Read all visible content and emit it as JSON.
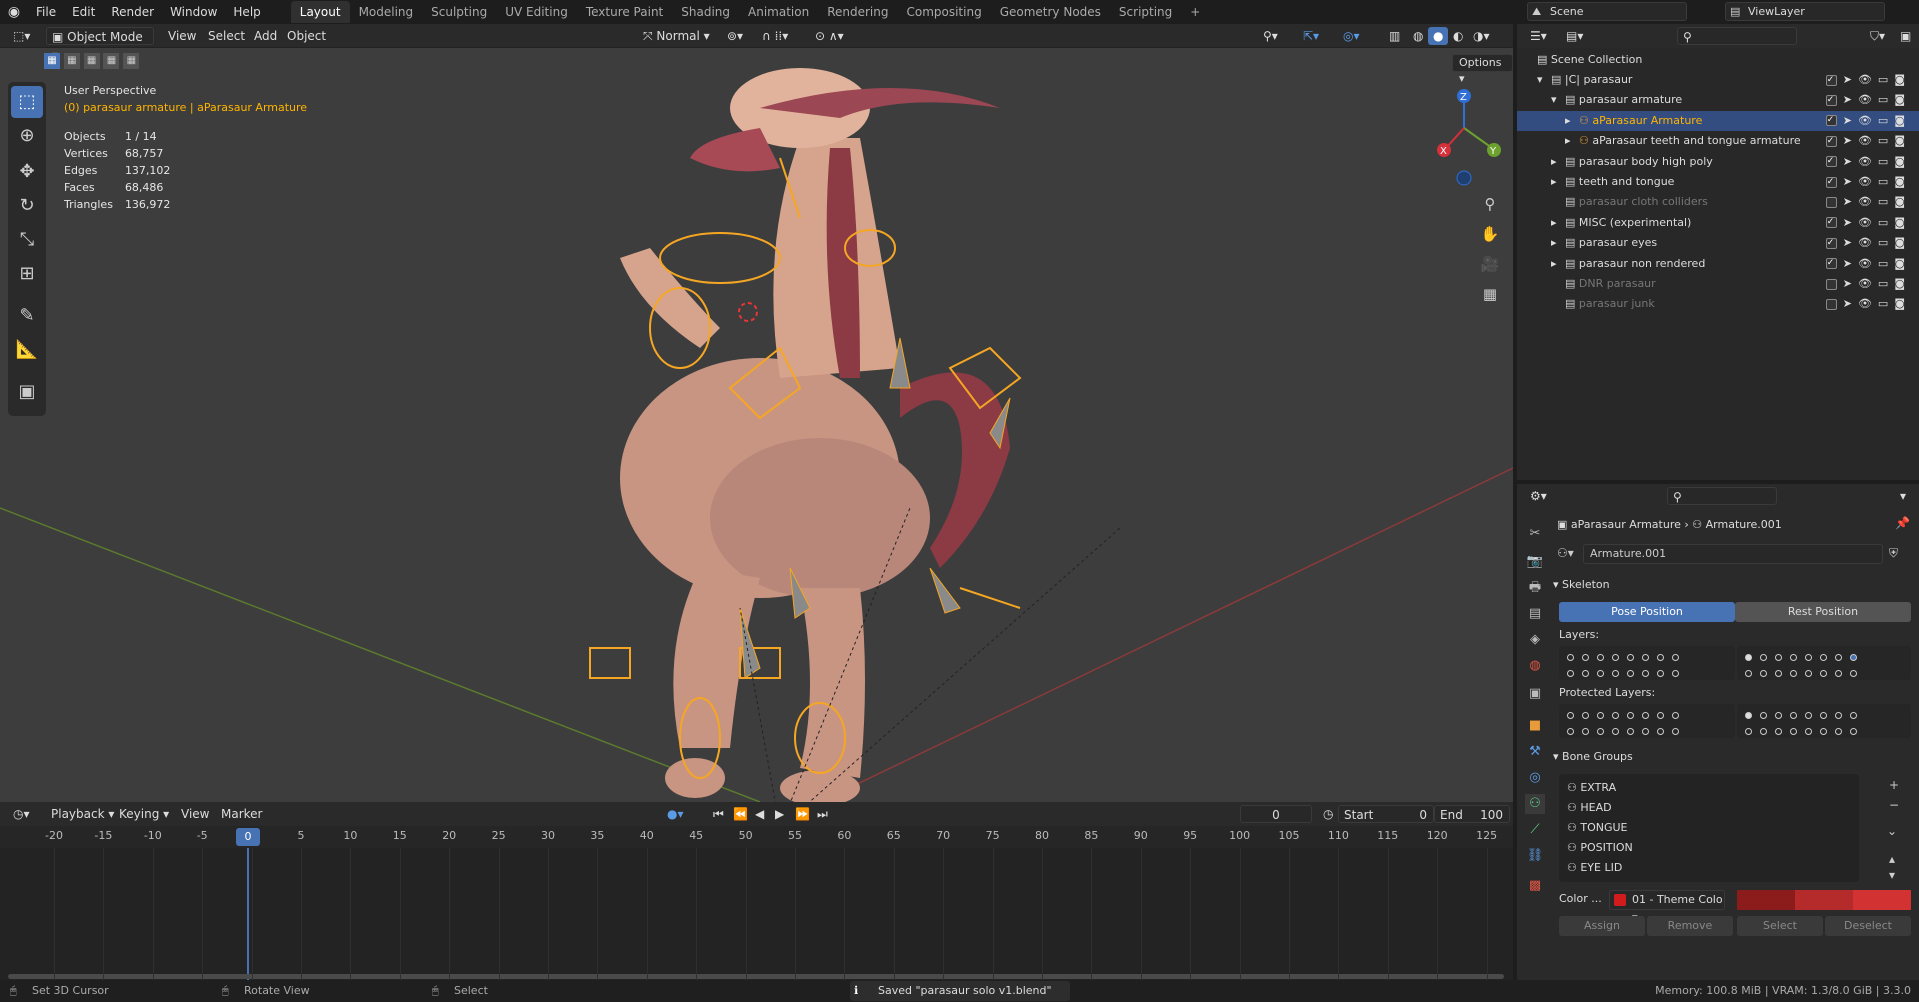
{
  "topbar": {
    "menus": [
      "File",
      "Edit",
      "Render",
      "Window",
      "Help"
    ],
    "workspaces": [
      "Layout",
      "Modeling",
      "Sculpting",
      "UV Editing",
      "Texture Paint",
      "Shading",
      "Animation",
      "Rendering",
      "Compositing",
      "Geometry Nodes",
      "Scripting"
    ],
    "add_ws": "+",
    "scene": "Scene",
    "view_layer": "ViewLayer"
  },
  "viewport": {
    "mode": "Object Mode",
    "menus": [
      "View",
      "Select",
      "Add",
      "Object"
    ],
    "orientation": "Normal",
    "options": "Options",
    "overlay_title": "User Perspective",
    "overlay_sub": "(0) parasaur armature | aParasaur Armature",
    "stats": [
      {
        "label": "Objects",
        "value": "1 / 14"
      },
      {
        "label": "Vertices",
        "value": "68,757"
      },
      {
        "label": "Edges",
        "value": "137,102"
      },
      {
        "label": "Faces",
        "value": "68,486"
      },
      {
        "label": "Triangles",
        "value": "136,972"
      }
    ],
    "gizmo": {
      "x": "X",
      "y": "Y",
      "z": "Z"
    }
  },
  "timeline": {
    "menus": [
      "Playback",
      "Keying",
      "View",
      "Marker"
    ],
    "current": "0",
    "start_label": "Start",
    "start": "0",
    "end_label": "End",
    "end": "100",
    "ticks": [
      "-20",
      "-15",
      "-10",
      "-5",
      "0",
      "5",
      "10",
      "15",
      "20",
      "25",
      "30",
      "35",
      "40",
      "45",
      "50",
      "55",
      "60",
      "65",
      "70",
      "75",
      "80",
      "85",
      "90",
      "95",
      "100",
      "105",
      "110",
      "115",
      "120",
      "125"
    ]
  },
  "outliner": {
    "root": "Scene Collection",
    "rows": [
      {
        "label": "|C| parasaur",
        "indent": 1,
        "exp": "▾",
        "dim": false,
        "sel": false
      },
      {
        "label": "parasaur armature",
        "indent": 2,
        "exp": "▾",
        "dim": false,
        "sel": false
      },
      {
        "label": "aParasaur Armature",
        "indent": 3,
        "exp": "▸",
        "dim": false,
        "sel": true
      },
      {
        "label": "aParasaur teeth and tongue armature",
        "indent": 3,
        "exp": "▸",
        "dim": false,
        "sel": false
      },
      {
        "label": "parasaur body high poly",
        "indent": 2,
        "exp": "▸",
        "dim": false,
        "sel": false
      },
      {
        "label": "teeth and tongue",
        "indent": 2,
        "exp": "▸",
        "dim": false,
        "sel": false
      },
      {
        "label": "parasaur cloth colliders",
        "indent": 2,
        "exp": "",
        "dim": true,
        "sel": false
      },
      {
        "label": "MISC (experimental)",
        "indent": 2,
        "exp": "▸",
        "dim": false,
        "sel": false
      },
      {
        "label": "parasaur eyes",
        "indent": 2,
        "exp": "▸",
        "dim": false,
        "sel": false
      },
      {
        "label": "parasaur non rendered",
        "indent": 2,
        "exp": "▸",
        "dim": false,
        "sel": false
      },
      {
        "label": "DNR parasaur",
        "indent": 2,
        "exp": "",
        "dim": true,
        "sel": false
      },
      {
        "label": "parasaur junk",
        "indent": 2,
        "exp": "",
        "dim": true,
        "sel": false
      }
    ]
  },
  "props": {
    "breadcrumb1": "aParasaur Armature",
    "breadcrumb2": "Armature.001",
    "datablock": "Armature.001",
    "skeleton": "Skeleton",
    "pose_position": "Pose Position",
    "rest_position": "Rest Position",
    "layers": "Layers:",
    "protected_layers": "Protected Layers:",
    "bone_groups": "Bone Groups",
    "groups": [
      "EXTRA",
      "HEAD",
      "TONGUE",
      "POSITION",
      "EYE LID"
    ],
    "color_label": "Color ...",
    "color_set": "01 - Theme Colo",
    "assign": "Assign",
    "remove": "Remove",
    "select": "Select",
    "deselect": "Deselect"
  },
  "status": {
    "set_cursor": "Set 3D Cursor",
    "rotate": "Rotate View",
    "select": "Select",
    "saved": "Saved \"parasaur solo v1.blend\"",
    "memory": "Memory: 100.8 MiB | VRAM: 1.3/8.0 GiB | 3.3.0"
  },
  "colors": {
    "accent": "#4772b3",
    "highlight": "#ffb400",
    "bone": "#f5a623"
  }
}
